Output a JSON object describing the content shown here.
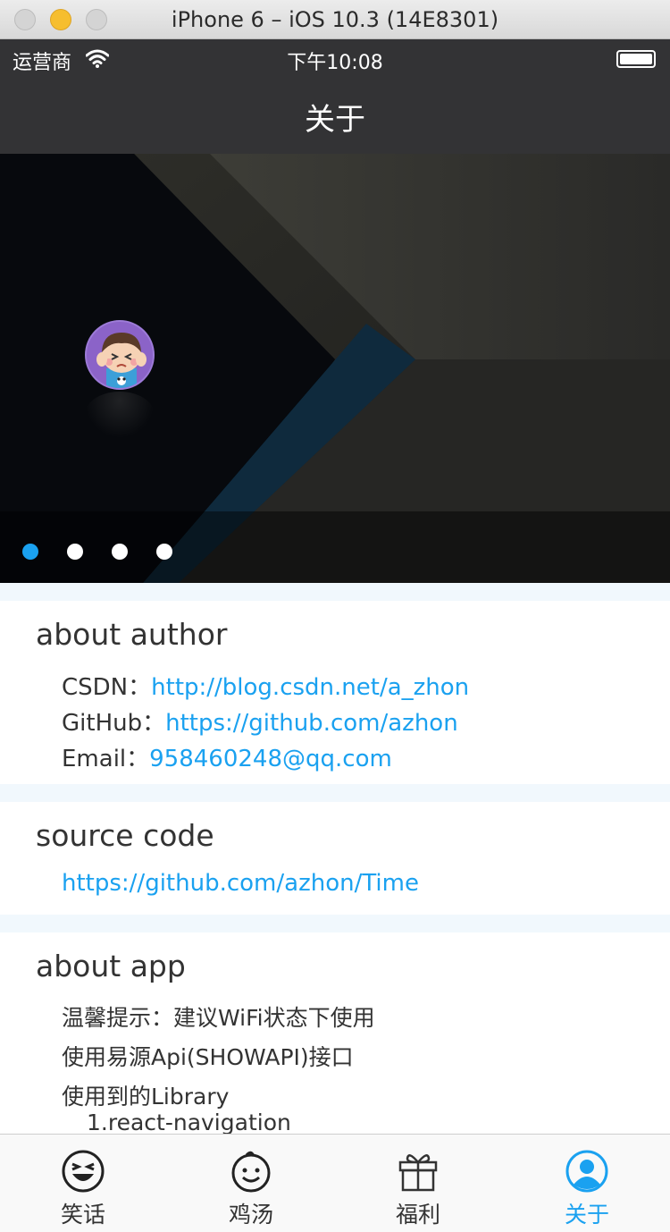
{
  "window": {
    "title": "iPhone 6 – iOS 10.3 (14E8301)"
  },
  "status_bar": {
    "carrier": "运营商",
    "time": "下午10:08"
  },
  "nav": {
    "title": "关于"
  },
  "banner": {
    "page_count": 4,
    "active_index": 0,
    "accent_color": "#1aa1f0"
  },
  "about_author": {
    "title": "about author",
    "csdn_label": "CSDN：",
    "csdn_url": "http://blog.csdn.net/a_zhon",
    "github_label": "GitHub：",
    "github_url": "https://github.com/azhon",
    "email_label": "Email：",
    "email_value": "958460248@qq.com"
  },
  "source_code": {
    "title": "source code",
    "url": "https://github.com/azhon/Time"
  },
  "about_app": {
    "title": "about app",
    "tip": "温馨提示：建议WiFi状态下使用",
    "api": "使用易源Api(SHOWAPI)接口",
    "libraries_label": "使用到的Library",
    "library_1": "1.react-navigation"
  },
  "tabs": [
    {
      "label": "笑话",
      "icon": "laughing-face-icon"
    },
    {
      "label": "鸡汤",
      "icon": "smiling-face-icon"
    },
    {
      "label": "福利",
      "icon": "gift-icon"
    },
    {
      "label": "关于",
      "icon": "user-icon"
    }
  ],
  "colors": {
    "link": "#1aa1f0",
    "bar": "#333335",
    "separator": "#f1f8fd"
  }
}
